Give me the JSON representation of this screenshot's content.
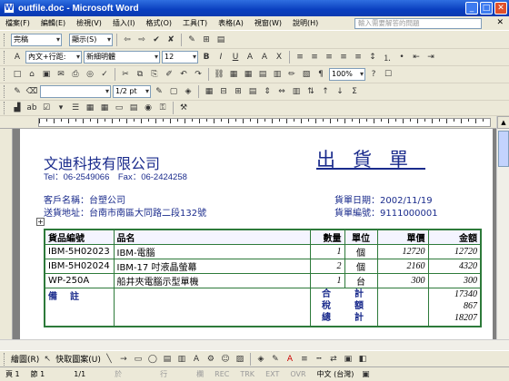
{
  "window": {
    "title": "outfile.doc - Microsoft Word",
    "app_icon": "W"
  },
  "menu": [
    "檔案(F)",
    "編輯(E)",
    "檢視(V)",
    "插入(I)",
    "格式(O)",
    "工具(T)",
    "表格(A)",
    "視窗(W)",
    "說明(H)"
  ],
  "help_placeholder": "輸入需要解答的問題",
  "toolbars": {
    "row1": {
      "style": "完稿",
      "display": "顯示(S)"
    },
    "row2": {
      "style": "內文+行距:",
      "font": "新細明體",
      "size": "12"
    },
    "row4": {
      "zoom": "100%",
      "line_width": "1/2 pt"
    }
  },
  "doc": {
    "company": "文迪科技有限公司",
    "contact": "Tel：06-2549066　Fax：06-2424258",
    "title": "出貨單",
    "customer_label": "客戶名稱：",
    "customer": "台塑公司",
    "address_label": "送貨地址：",
    "address": "台南市南區大同路二段132號",
    "date_label": "貨單日期：",
    "date": "2002/11/19",
    "number_label": "貨單編號：",
    "number": "9111000001",
    "table": {
      "headers": [
        "貨品編號",
        "品名",
        "數量",
        "單位",
        "單價",
        "金額"
      ],
      "rows": [
        [
          "IBM-5H02023",
          "IBM-電腦",
          "1",
          "個",
          "12720",
          "12720"
        ],
        [
          "IBM-5H02024",
          "IBM-17 吋液晶螢幕",
          "2",
          "個",
          "2160",
          "4320"
        ],
        [
          "WP-250A",
          "船井夾電腦示型單機",
          "1",
          "台",
          "300",
          "300"
        ]
      ],
      "remark_label": "備　註",
      "total_labels": [
        "合　　計",
        "稅　　額",
        "總　　計"
      ],
      "total_values": [
        "17340",
        "867",
        "18207"
      ]
    }
  },
  "drawbar": {
    "draw": "繪圖(R)",
    "autoshape": "快取圖案(U)"
  },
  "status": {
    "page": "頁 1",
    "section": "節 1",
    "pos": "1/1",
    "at": "於",
    "line": "行",
    "col": "欄",
    "rec": "REC",
    "trk": "TRK",
    "ext": "EXT",
    "ovr": "OVR",
    "lang": "中文 (台灣)"
  }
}
